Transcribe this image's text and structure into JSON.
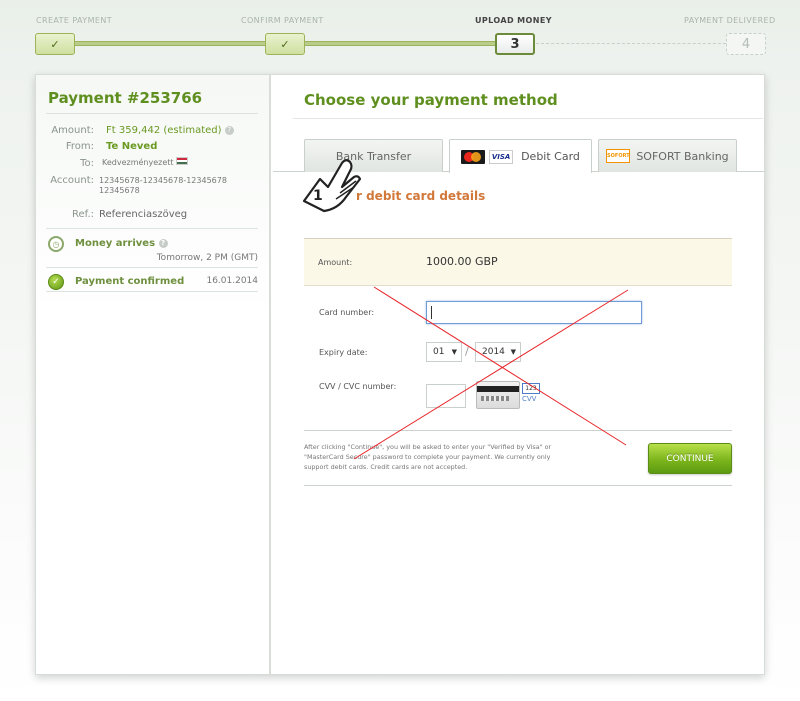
{
  "steps": [
    {
      "label": "CREATE PAYMENT",
      "marker": "✓",
      "state": "done"
    },
    {
      "label": "CONFIRM PAYMENT",
      "marker": "✓",
      "state": "done"
    },
    {
      "label": "UPLOAD MONEY",
      "marker": "3",
      "state": "current"
    },
    {
      "label": "PAYMENT DELIVERED",
      "marker": "4",
      "state": "future"
    }
  ],
  "sidebar": {
    "title": "Payment #253766",
    "amount_label": "Amount:",
    "amount_value": "Ft 359,442 (estimated)",
    "from_label": "From:",
    "from_value": "Te Neved",
    "to_label": "To:",
    "to_value": "Kedvezményezett",
    "account_label": "Account:",
    "account_value": "12345678-12345678-12345678 12345678",
    "ref_label": "Ref.:",
    "ref_value": "Referenciaszöveg",
    "money_arrives_label": "Money arrives",
    "money_arrives_value": "Tomorrow, 2 PM (GMT)",
    "payment_confirmed_label": "Payment confirmed",
    "payment_confirmed_date": "16.01.2014",
    "help_glyph": "?"
  },
  "content": {
    "title": "Choose your payment method",
    "tabs": [
      {
        "label": "Bank Transfer"
      },
      {
        "label": "Debit Card",
        "logo_mc": "mastercard-logo",
        "logo_visa": "VISA"
      },
      {
        "label": "SOFORT Banking",
        "logo": "SOFORT"
      }
    ],
    "details_heading": "r debit card details",
    "annotation_number": "1",
    "amount_label": "Amount:",
    "amount_value": "1000.00 GBP",
    "card_number_label": "Card number:",
    "expiry_label": "Expiry date:",
    "expiry_month": "01",
    "expiry_year": "2014",
    "expiry_separator": "/",
    "cvv_label": "CVV / CVC number:",
    "cvv_sample": "123",
    "cvv_text": "CVV",
    "note": "After clicking \"Continue\", you will be asked to enter your \"Verified by Visa\" or \"MasterCard Secure\" password to complete your payment. We currently only support debit cards. Credit cards are not accepted.",
    "continue_label": "CONTINUE"
  },
  "colors": {
    "accent_green": "#5f8f1f",
    "heading_orange": "#d2783a",
    "cross_red": "#e8262a",
    "button_green": "#7cb51c"
  }
}
